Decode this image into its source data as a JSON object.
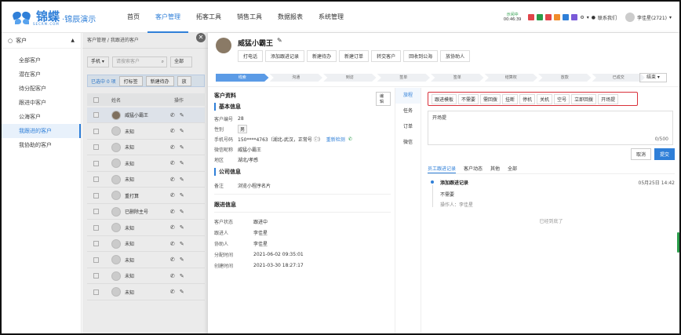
{
  "nav": {
    "logo_text": "锦蝶",
    "logo_sub": "SECRM.COM",
    "logo_tag": "·锦辰演示",
    "items": [
      "首页",
      "客户管理",
      "拓客工具",
      "销售工具",
      "数据报表",
      "系统管理"
    ],
    "active_index": 1,
    "status": "示闲中",
    "timer": "00:46:39",
    "contact": "联系我们",
    "user": "李佳星(2721)"
  },
  "sidebar": {
    "header": "客户",
    "items": [
      "全部客户",
      "潜在客户",
      "待分配客户",
      "跟进中客户",
      "公海客户",
      "我跟进的客户",
      "我协助的客户"
    ],
    "active_index": 5
  },
  "list": {
    "breadcrumb": "客户管理 / 我跟进的客户",
    "phone_select": "手机",
    "search_placeholder": "请搜索客户",
    "scope": "全部",
    "selected_text": "已选中 0 项",
    "btn_tag": "打标签",
    "btn_pending": "新建待办",
    "btn_more": "放",
    "col_name": "姓名",
    "col_op": "操作",
    "rows": [
      "威猛小霸王",
      "未知",
      "未知",
      "未知",
      "未知",
      "重打算",
      "已删除主号",
      "未知",
      "未知",
      "未知",
      "未知",
      "未知"
    ]
  },
  "drawer": {
    "name": "威猛小霸王",
    "actions": [
      "打电话",
      "添加跟进记录",
      "新建待办",
      "新建订单",
      "转交客户",
      "回收到公海",
      "放协助人"
    ],
    "steps": [
      "线索",
      "沟通",
      "到访",
      "签单",
      "签单",
      "结算权",
      "放款",
      "已成交"
    ],
    "end_label": "结束",
    "profile": {
      "title": "客户资料",
      "edit": "编辑",
      "basic_title": "基本信息",
      "fields": [
        {
          "k": "客户编号",
          "v": "28"
        },
        {
          "k": "性别",
          "v": "男"
        },
        {
          "k": "手机号码",
          "v": "150****4763（湖北-武汉，正常号 ⓘ）"
        },
        {
          "k": "微信昵称",
          "v": "威猛小霸王"
        },
        {
          "k": "地区",
          "v": "湖北/孝感"
        }
      ],
      "recheck": "重新检测",
      "company_title": "公司信息",
      "remark_k": "备注",
      "remark_v": "浏览小程序名片",
      "follow_title": "跟进信息",
      "follow_fields": [
        {
          "k": "客户状态",
          "v": "跟进中"
        },
        {
          "k": "跟进人",
          "v": "李佳星"
        },
        {
          "k": "协助人",
          "v": "李佳星"
        },
        {
          "k": "分配时间",
          "v": "2021-06-02 09:35:01"
        },
        {
          "k": "创建时间",
          "v": "2021-03-30 18:27:17"
        }
      ]
    },
    "vtabs": [
      "旅程",
      "任务",
      "订单",
      "微信"
    ],
    "followup": {
      "quick": [
        "跟进模板",
        "不需要",
        "需回拨",
        "挂断",
        "停机",
        "关机",
        "空号",
        "立即回拨",
        "开场提"
      ],
      "text": "开场提",
      "counter": "0/500",
      "cancel": "取消",
      "submit": "提交",
      "subtabs": [
        "员工跟进记录",
        "客户动态",
        "其他",
        "全部"
      ],
      "record": {
        "title": "添加跟进记录",
        "time": "05月25日 14:42",
        "body": "不需要",
        "operator": "操作人：李佳星"
      },
      "bottom": "已经到底了"
    }
  }
}
